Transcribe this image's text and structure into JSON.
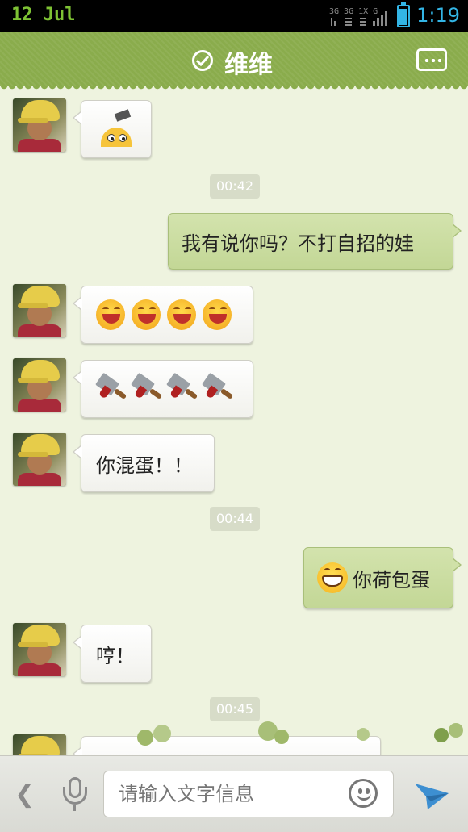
{
  "status_bar": {
    "date": "12  Jul",
    "time": "1:19",
    "network_indicators": "3G 3G 1X G"
  },
  "header": {
    "title": "维维",
    "verified_icon": "check-circle-icon",
    "menu_icon": "more-icon"
  },
  "messages": [
    {
      "side": "left",
      "content": "peeking-emoji-sticker"
    },
    {
      "type": "timestamp",
      "text": "00:42"
    },
    {
      "side": "right",
      "text": "我有说你吗？不打自招的娃"
    },
    {
      "side": "left",
      "content": "laughing-emoji-x4"
    },
    {
      "side": "left",
      "content": "cleaver-emoji-x4"
    },
    {
      "side": "left",
      "text": "你混蛋！！"
    },
    {
      "type": "timestamp",
      "text": "00:44"
    },
    {
      "side": "right",
      "text": "你荷包蛋",
      "prefix_icon": "grin-emoji"
    },
    {
      "side": "left",
      "text": "哼！"
    },
    {
      "type": "timestamp",
      "text": "00:45"
    }
  ],
  "input_bar": {
    "placeholder": "请输入文字信息",
    "back_icon": "chevron-left-icon",
    "mic_icon": "microphone-icon",
    "emoji_icon": "smiley-icon",
    "send_icon": "send-icon"
  },
  "colors": {
    "header_green": "#8aac4c",
    "chat_bg": "#eef3df",
    "outgoing_bubble": "#c9dc9f",
    "incoming_bubble": "#ffffff",
    "status_time": "#33b5e5",
    "status_date": "#7ec234"
  }
}
